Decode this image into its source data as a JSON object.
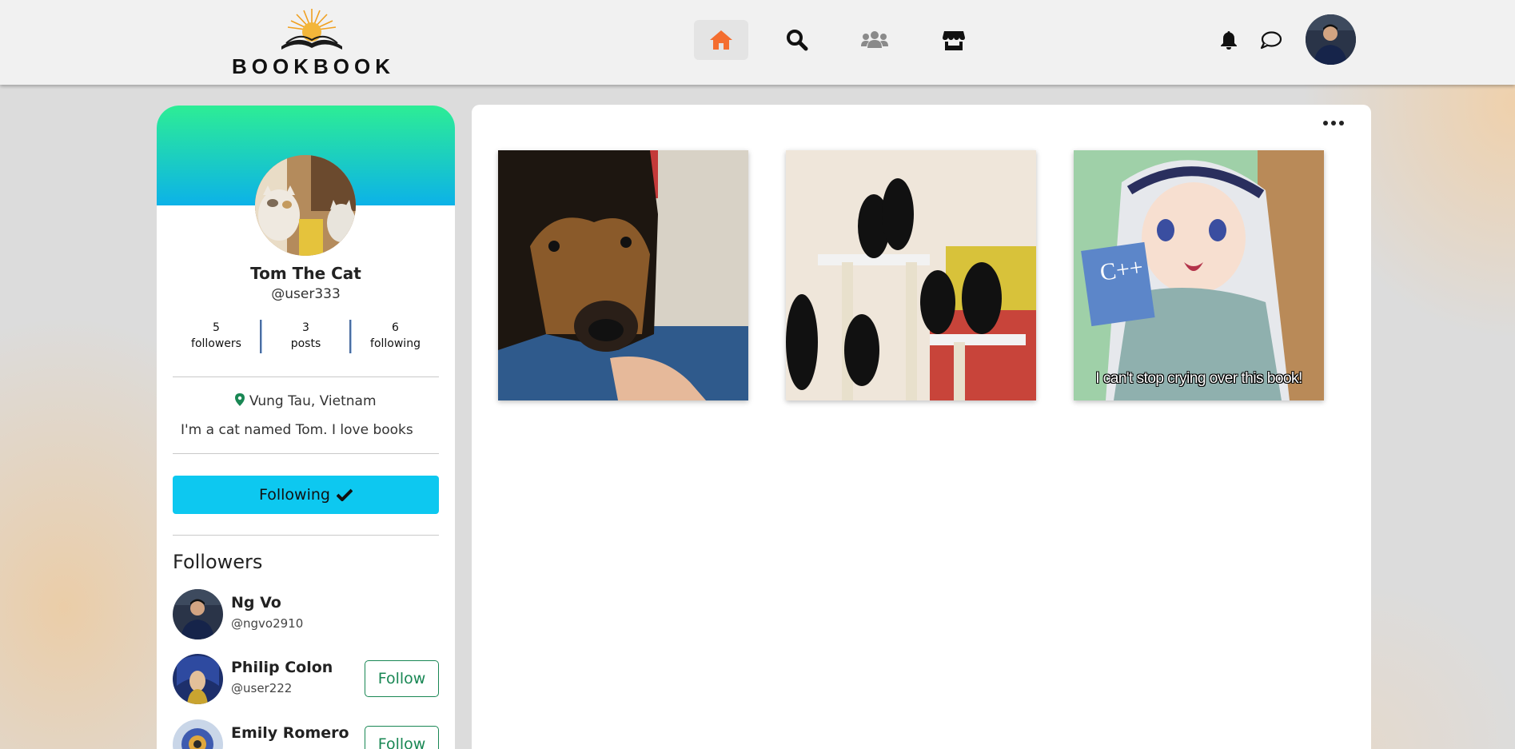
{
  "app": {
    "logo_text": "BOOKBOOK"
  },
  "nav": [
    {
      "name": "home",
      "icon": "home-icon",
      "active": true
    },
    {
      "name": "search",
      "icon": "search-icon",
      "active": false
    },
    {
      "name": "groups",
      "icon": "users-icon",
      "active": false
    },
    {
      "name": "marketplace",
      "icon": "store-icon",
      "active": false
    }
  ],
  "colors": {
    "accent": "#f46d2f",
    "follow_button": "#0dc8f0",
    "outline_green": "#198754",
    "cover_top": "#2ded95",
    "cover_bottom": "#0cb2e8"
  },
  "profile": {
    "name": "Tom The Cat",
    "handle": "@user333",
    "stats": [
      {
        "value": "5",
        "label": "followers"
      },
      {
        "value": "3",
        "label": "posts"
      },
      {
        "value": "6",
        "label": "following"
      }
    ],
    "location": "Vung Tau, Vietnam",
    "bio": "I'm a cat named Tom. I love books",
    "follow_label": "Following"
  },
  "followers": {
    "title": "Followers",
    "items": [
      {
        "name": "Ng Vo",
        "handle": "@ngvo2910"
      },
      {
        "name": "Philip Colon",
        "handle": "@user222",
        "button": "Follow"
      },
      {
        "name": "Emily Romero",
        "handle": "",
        "button": "Follow"
      }
    ]
  },
  "posts": [
    {
      "alt": "dog"
    },
    {
      "alt": "black cats"
    },
    {
      "alt": "anime girl with C++ book",
      "caption": "I can't stop crying over this book!"
    }
  ]
}
